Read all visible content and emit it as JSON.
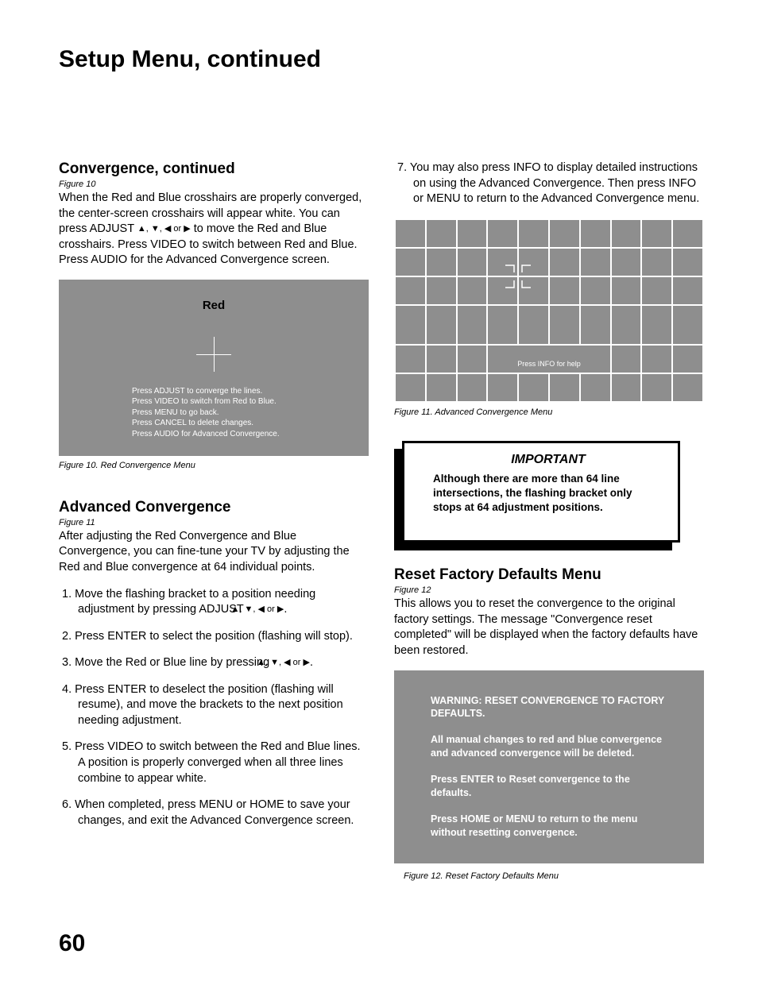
{
  "page_title": "Setup Menu, continued",
  "page_number": "60",
  "left": {
    "convergence": {
      "heading": "Convergence, continued",
      "fig_ref": "Figure 10",
      "para_a": "When the Red and Blue crosshairs are properly converged, the center-screen crosshairs will appear white.  You can press ADJUST ",
      "para_b": " to move the Red and Blue crosshairs.  Press VIDEO to switch between Red and Blue.  Press AUDIO for the Advanced Convergence screen."
    },
    "fig10": {
      "label": "Red",
      "line1": "Press ADJUST to converge the lines.",
      "line2": "Press VIDEO to switch from Red to Blue.",
      "line3": "Press MENU to go back.",
      "line4": "Press CANCEL to delete changes.",
      "line5": "Press AUDIO for Advanced Convergence.",
      "caption": "Figure 10. Red Convergence Menu"
    },
    "advanced": {
      "heading": "Advanced Convergence",
      "fig_ref": "Figure 11",
      "intro": "After adjusting the Red Convergence and Blue Convergence, you can fine-tune your TV by adjusting the Red and Blue convergence at 64 individual points.",
      "step1_a": "1.  Move the flashing bracket to a position needing adjustment by pressing ADJUST ",
      "step1_b": ".",
      "step2": "2.  Press ENTER to select the position (flashing will stop).",
      "step3_a": "3.  Move the Red or Blue line by pressing ",
      "step3_b": ".",
      "step4": "4.  Press ENTER to deselect the position (flashing will resume), and move the brackets to the next position needing adjustment.",
      "step5": "5.  Press VIDEO to switch between the Red and Blue lines.  A position is properly converged when all three lines combine to appear white.",
      "step6": "6.  When completed, press MENU or HOME to save your changes, and exit the Advanced Convergence screen."
    }
  },
  "right": {
    "step7": "7.  You may also press INFO to display detailed instructions on using the Advanced Convergence. Then press INFO or MENU to return to the Advanced Convergence menu.",
    "fig11": {
      "help_text": "Press INFO for help",
      "caption": "Figure 11.  Advanced Convergence Menu"
    },
    "important": {
      "title": "IMPORTANT",
      "body": "Although there are more than 64 line intersections, the flashing bracket only stops at 64 adjustment positions."
    },
    "reset": {
      "heading": "Reset Factory Defaults Menu",
      "fig_ref": "Figure 12",
      "intro": "This allows you to reset the convergence to the original factory settings.  The message \"Convergence reset completed\" will be displayed when the factory defaults have been restored."
    },
    "fig12": {
      "p1": "WARNING:  RESET CONVERGENCE TO FACTORY DEFAULTS.",
      "p2": "All manual changes to red and blue convergence and advanced convergence will be deleted.",
      "p3": "Press ENTER to Reset convergence to the defaults.",
      "p4": "Press HOME or MENU to return to the menu without resetting convergence.",
      "caption": "Figure 12. Reset Factory Defaults Menu"
    }
  },
  "arrows_seq": "▲, ▼, ◀ or ▶"
}
